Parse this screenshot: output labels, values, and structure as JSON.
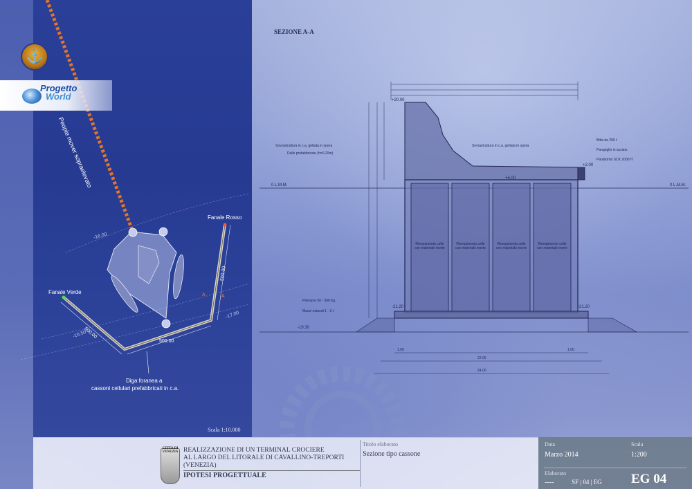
{
  "left_panel": {
    "people_mover_label": "People mover sopraelevato",
    "fanale_rosso": "Fanale Rosso",
    "fanale_verde": "Fanale Verde",
    "diga_line1": "Diga foranea a",
    "diga_line2": "cassoni cellulari prefabbricati in c.a.",
    "dim_500a": "500.00",
    "dim_500b": "500.00",
    "dim_500c": "500.00",
    "contour_16": "-16.00",
    "contour_16_50": "-16.50",
    "contour_17": "-17.00",
    "scala": "Scala 1:10.000",
    "logo_line1": "Progetto",
    "logo_line2": "World"
  },
  "section": {
    "title": "SEZIONE A-A",
    "top_level": "+20.00",
    "slab_level": "+2.00",
    "mid_level": "+5.00",
    "base_left_level": "-21.20",
    "base_right_level": "-21.20",
    "seabed_level": "-19.30",
    "lmm_left": "0 L.M.M.",
    "lmm_right": "0 L.M.M.",
    "notes": {
      "sovrastruttura_left": "Sovrastruttura in c.a. gettata in opera",
      "dalle": "Dalle prefabbricate (h=0.20m)",
      "sovrastruttura_right": "Sovrastruttura in c.a. gettata in opera",
      "bitta": "Bitta da 250 t",
      "parapiglio": "Parapiglio in acciaio",
      "parabordo": "Parabordo SCK 2000 H",
      "pietrame": "Pietrame 50 - 500 Kg",
      "massi": "Massi naturali 1 - 3 t"
    },
    "cells": [
      "Riempimento celle con materiale inerte",
      "Riempimento celle con materiale inerte",
      "Riempimento celle con materiale inerte",
      "Riempimento celle con materiale inerte"
    ],
    "dims_bottom": [
      "1.00",
      "22.00",
      "1.00",
      "24.00"
    ]
  },
  "titleblock": {
    "crest_label": "CITTÀ DI VENEZIA",
    "line1": "REALIZZAZIONE DI UN TERMINAL CROCIERE",
    "line2": "AL LARGO DEL LITORALE DI CAVALLINO-TREPORTI",
    "line3": "(VENEZIA)",
    "line4": "IPOTESI PROGETTUALE",
    "titolo_label": "Titolo elaborato",
    "titolo_value": "Sezione tipo cassone",
    "data_label": "Data",
    "data_value": "Marzo 2014",
    "scala_label": "Scala",
    "scala_value": "1:200",
    "elaborato_label": "Elaborato",
    "elaborato_value": "----",
    "codes": "SF | 04 | EG",
    "code_big": "EG 04"
  },
  "colors": {
    "left_panel": "#2a3f98",
    "caisson_fill": "#6f7cb2",
    "line": "#1f2452",
    "people_mover": "#e2742a"
  }
}
